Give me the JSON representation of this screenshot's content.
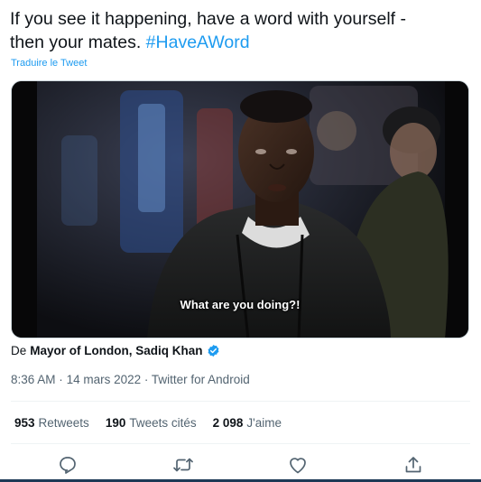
{
  "tweet": {
    "text_line1": "If you see it happening, have a word with yourself -",
    "text_line2": "then your mates.",
    "hashtag": "#HaveAWord",
    "translate": "Traduire le Tweet"
  },
  "video": {
    "caption": "What are you doing?!"
  },
  "byline": {
    "prefix": "De",
    "author": "Mayor of London, Sadiq Khan"
  },
  "meta": {
    "time": "8:36 AM",
    "date": "14 mars 2022",
    "source": "Twitter for Android",
    "separator": "·"
  },
  "stats": {
    "retweets_count": "953",
    "retweets_label": "Retweets",
    "quotes_count": "190",
    "quotes_label": "Tweets cités",
    "likes_count": "2 098",
    "likes_label": "J'aime"
  },
  "icons": {
    "reply": "reply-icon",
    "retweet": "retweet-icon",
    "like": "like-icon",
    "share": "share-icon",
    "verified": "verified-badge-icon"
  },
  "colors": {
    "accent": "#1d9bf0",
    "text": "#0f1419",
    "muted": "#536471"
  }
}
